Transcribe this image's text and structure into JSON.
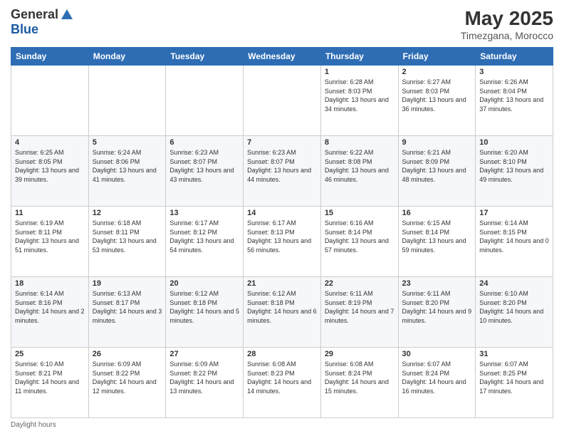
{
  "header": {
    "logo_general": "General",
    "logo_blue": "Blue",
    "month_title": "May 2025",
    "subtitle": "Timezgana, Morocco"
  },
  "days_of_week": [
    "Sunday",
    "Monday",
    "Tuesday",
    "Wednesday",
    "Thursday",
    "Friday",
    "Saturday"
  ],
  "weeks": [
    [
      {
        "day": "",
        "sunrise": "",
        "sunset": "",
        "daylight": ""
      },
      {
        "day": "",
        "sunrise": "",
        "sunset": "",
        "daylight": ""
      },
      {
        "day": "",
        "sunrise": "",
        "sunset": "",
        "daylight": ""
      },
      {
        "day": "",
        "sunrise": "",
        "sunset": "",
        "daylight": ""
      },
      {
        "day": "1",
        "sunrise": "Sunrise: 6:28 AM",
        "sunset": "Sunset: 8:03 PM",
        "daylight": "Daylight: 13 hours and 34 minutes."
      },
      {
        "day": "2",
        "sunrise": "Sunrise: 6:27 AM",
        "sunset": "Sunset: 8:03 PM",
        "daylight": "Daylight: 13 hours and 36 minutes."
      },
      {
        "day": "3",
        "sunrise": "Sunrise: 6:26 AM",
        "sunset": "Sunset: 8:04 PM",
        "daylight": "Daylight: 13 hours and 37 minutes."
      }
    ],
    [
      {
        "day": "4",
        "sunrise": "Sunrise: 6:25 AM",
        "sunset": "Sunset: 8:05 PM",
        "daylight": "Daylight: 13 hours and 39 minutes."
      },
      {
        "day": "5",
        "sunrise": "Sunrise: 6:24 AM",
        "sunset": "Sunset: 8:06 PM",
        "daylight": "Daylight: 13 hours and 41 minutes."
      },
      {
        "day": "6",
        "sunrise": "Sunrise: 6:23 AM",
        "sunset": "Sunset: 8:07 PM",
        "daylight": "Daylight: 13 hours and 43 minutes."
      },
      {
        "day": "7",
        "sunrise": "Sunrise: 6:23 AM",
        "sunset": "Sunset: 8:07 PM",
        "daylight": "Daylight: 13 hours and 44 minutes."
      },
      {
        "day": "8",
        "sunrise": "Sunrise: 6:22 AM",
        "sunset": "Sunset: 8:08 PM",
        "daylight": "Daylight: 13 hours and 46 minutes."
      },
      {
        "day": "9",
        "sunrise": "Sunrise: 6:21 AM",
        "sunset": "Sunset: 8:09 PM",
        "daylight": "Daylight: 13 hours and 48 minutes."
      },
      {
        "day": "10",
        "sunrise": "Sunrise: 6:20 AM",
        "sunset": "Sunset: 8:10 PM",
        "daylight": "Daylight: 13 hours and 49 minutes."
      }
    ],
    [
      {
        "day": "11",
        "sunrise": "Sunrise: 6:19 AM",
        "sunset": "Sunset: 8:11 PM",
        "daylight": "Daylight: 13 hours and 51 minutes."
      },
      {
        "day": "12",
        "sunrise": "Sunrise: 6:18 AM",
        "sunset": "Sunset: 8:11 PM",
        "daylight": "Daylight: 13 hours and 53 minutes."
      },
      {
        "day": "13",
        "sunrise": "Sunrise: 6:17 AM",
        "sunset": "Sunset: 8:12 PM",
        "daylight": "Daylight: 13 hours and 54 minutes."
      },
      {
        "day": "14",
        "sunrise": "Sunrise: 6:17 AM",
        "sunset": "Sunset: 8:13 PM",
        "daylight": "Daylight: 13 hours and 56 minutes."
      },
      {
        "day": "15",
        "sunrise": "Sunrise: 6:16 AM",
        "sunset": "Sunset: 8:14 PM",
        "daylight": "Daylight: 13 hours and 57 minutes."
      },
      {
        "day": "16",
        "sunrise": "Sunrise: 6:15 AM",
        "sunset": "Sunset: 8:14 PM",
        "daylight": "Daylight: 13 hours and 59 minutes."
      },
      {
        "day": "17",
        "sunrise": "Sunrise: 6:14 AM",
        "sunset": "Sunset: 8:15 PM",
        "daylight": "Daylight: 14 hours and 0 minutes."
      }
    ],
    [
      {
        "day": "18",
        "sunrise": "Sunrise: 6:14 AM",
        "sunset": "Sunset: 8:16 PM",
        "daylight": "Daylight: 14 hours and 2 minutes."
      },
      {
        "day": "19",
        "sunrise": "Sunrise: 6:13 AM",
        "sunset": "Sunset: 8:17 PM",
        "daylight": "Daylight: 14 hours and 3 minutes."
      },
      {
        "day": "20",
        "sunrise": "Sunrise: 6:12 AM",
        "sunset": "Sunset: 8:18 PM",
        "daylight": "Daylight: 14 hours and 5 minutes."
      },
      {
        "day": "21",
        "sunrise": "Sunrise: 6:12 AM",
        "sunset": "Sunset: 8:18 PM",
        "daylight": "Daylight: 14 hours and 6 minutes."
      },
      {
        "day": "22",
        "sunrise": "Sunrise: 6:11 AM",
        "sunset": "Sunset: 8:19 PM",
        "daylight": "Daylight: 14 hours and 7 minutes."
      },
      {
        "day": "23",
        "sunrise": "Sunrise: 6:11 AM",
        "sunset": "Sunset: 8:20 PM",
        "daylight": "Daylight: 14 hours and 9 minutes."
      },
      {
        "day": "24",
        "sunrise": "Sunrise: 6:10 AM",
        "sunset": "Sunset: 8:20 PM",
        "daylight": "Daylight: 14 hours and 10 minutes."
      }
    ],
    [
      {
        "day": "25",
        "sunrise": "Sunrise: 6:10 AM",
        "sunset": "Sunset: 8:21 PM",
        "daylight": "Daylight: 14 hours and 11 minutes."
      },
      {
        "day": "26",
        "sunrise": "Sunrise: 6:09 AM",
        "sunset": "Sunset: 8:22 PM",
        "daylight": "Daylight: 14 hours and 12 minutes."
      },
      {
        "day": "27",
        "sunrise": "Sunrise: 6:09 AM",
        "sunset": "Sunset: 8:22 PM",
        "daylight": "Daylight: 14 hours and 13 minutes."
      },
      {
        "day": "28",
        "sunrise": "Sunrise: 6:08 AM",
        "sunset": "Sunset: 8:23 PM",
        "daylight": "Daylight: 14 hours and 14 minutes."
      },
      {
        "day": "29",
        "sunrise": "Sunrise: 6:08 AM",
        "sunset": "Sunset: 8:24 PM",
        "daylight": "Daylight: 14 hours and 15 minutes."
      },
      {
        "day": "30",
        "sunrise": "Sunrise: 6:07 AM",
        "sunset": "Sunset: 8:24 PM",
        "daylight": "Daylight: 14 hours and 16 minutes."
      },
      {
        "day": "31",
        "sunrise": "Sunrise: 6:07 AM",
        "sunset": "Sunset: 8:25 PM",
        "daylight": "Daylight: 14 hours and 17 minutes."
      }
    ]
  ],
  "footer": {
    "note": "Daylight hours"
  }
}
